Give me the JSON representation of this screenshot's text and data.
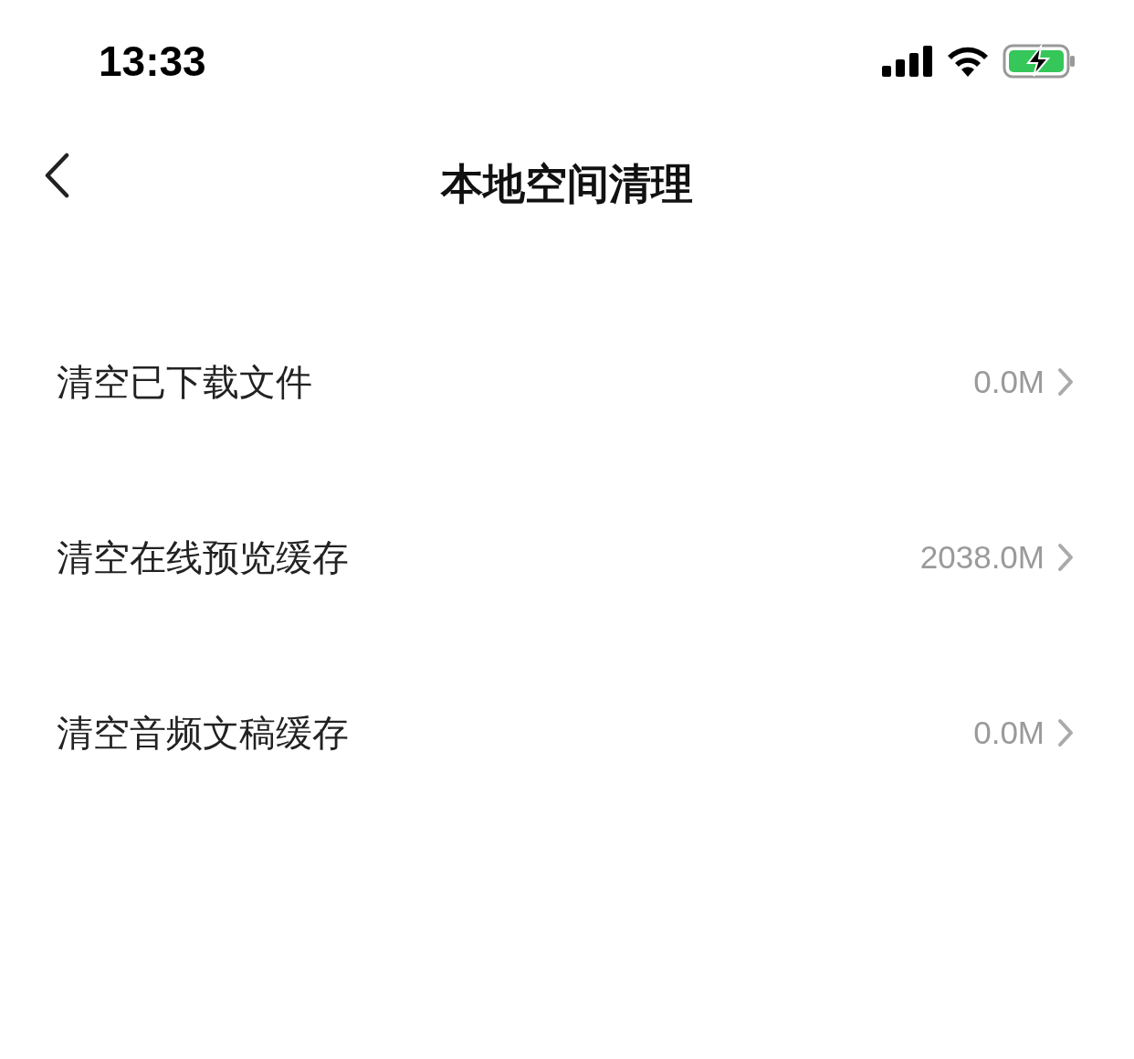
{
  "status_bar": {
    "time": "13:33"
  },
  "nav": {
    "title": "本地空间清理"
  },
  "items": [
    {
      "label": "清空已下载文件",
      "value": "0.0M"
    },
    {
      "label": "清空在线预览缓存",
      "value": "2038.0M"
    },
    {
      "label": "清空音频文稿缓存",
      "value": "0.0M"
    }
  ]
}
